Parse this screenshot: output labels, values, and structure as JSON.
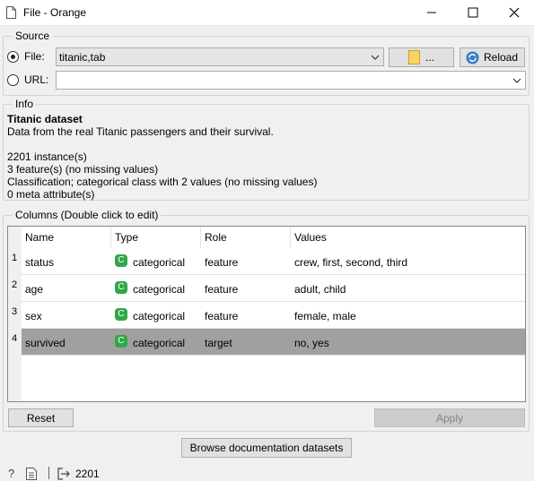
{
  "window": {
    "title": "File - Orange"
  },
  "source": {
    "group_title": "Source",
    "file_label": "File:",
    "file_value": "titanic,tab",
    "browse_label": "...",
    "reload_label": "Reload",
    "url_label": "URL:",
    "url_value": ""
  },
  "info": {
    "group_title": "Info",
    "dataset_title": "Titanic dataset",
    "description": "Data from the real Titanic passengers and their survival.",
    "instances": "2201 instance(s)",
    "features": "3 feature(s) (no missing values)",
    "classification": "Classification; categorical class with 2 values (no missing values)",
    "meta": "0 meta attribute(s)"
  },
  "columns": {
    "group_title": "Columns (Double click to edit)",
    "headers": [
      "Name",
      "Type",
      "Role",
      "Values"
    ],
    "rows": [
      {
        "num": "1",
        "name": "status",
        "type_icon": "C",
        "type": "categorical",
        "role": "feature",
        "values": "crew, first, second, third"
      },
      {
        "num": "2",
        "name": "age",
        "type_icon": "C",
        "type": "categorical",
        "role": "feature",
        "values": "adult, child"
      },
      {
        "num": "3",
        "name": "sex",
        "type_icon": "C",
        "type": "categorical",
        "role": "feature",
        "values": "female, male"
      },
      {
        "num": "4",
        "name": "survived",
        "type_icon": "C",
        "type": "categorical",
        "role": "target",
        "values": "no, yes"
      }
    ],
    "selected_row": 4
  },
  "buttons": {
    "reset_label": "Reset",
    "apply_label": "Apply",
    "browse_docs_label": "Browse documentation datasets"
  },
  "status": {
    "output_count": "2201"
  },
  "colors": {
    "categorical_icon": "#2fa84a",
    "selected_row": "#a0a0a0",
    "background": "#f0f0f0"
  },
  "icons": [
    "file-icon",
    "minimize-icon",
    "maximize-icon",
    "close-icon",
    "folder-icon",
    "reload-icon",
    "chevron-down-icon",
    "help-icon",
    "report-icon",
    "output-icon"
  ]
}
